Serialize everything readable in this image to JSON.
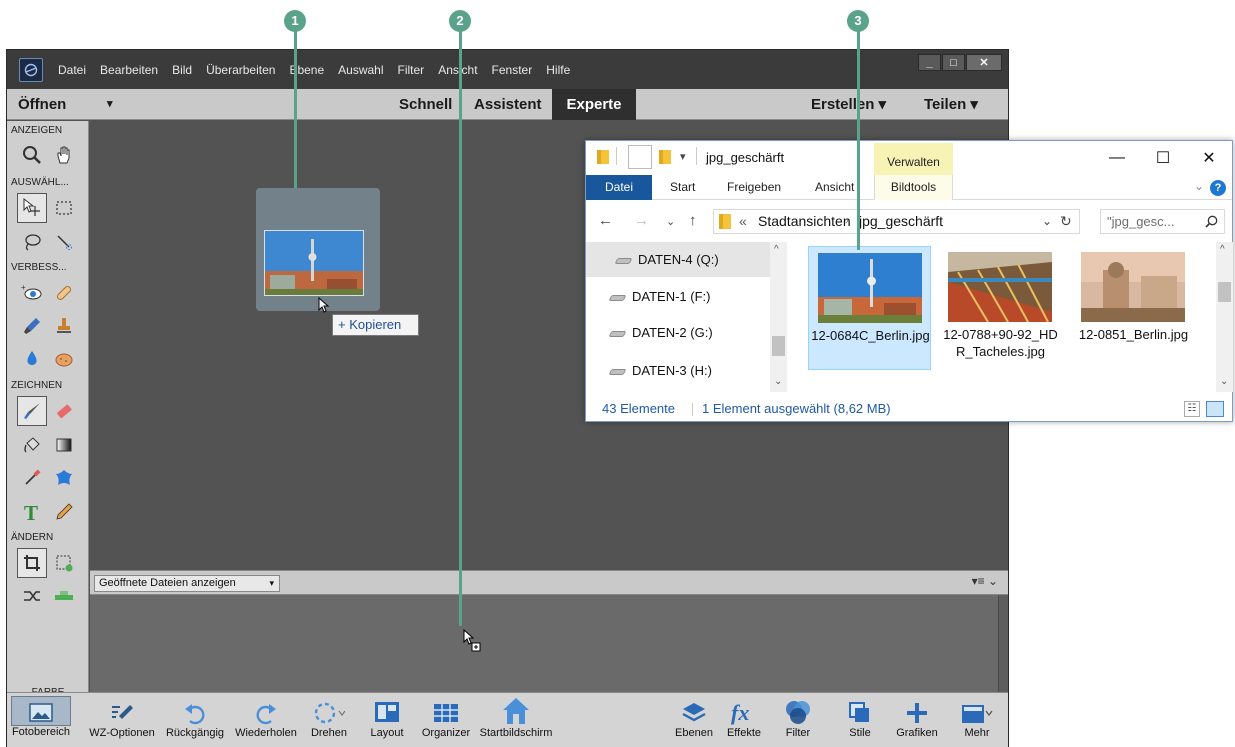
{
  "menubar": {
    "items": [
      "Datei",
      "Bearbeiten",
      "Bild",
      "Überarbeiten",
      "Ebene",
      "Auswahl",
      "Filter",
      "Ansicht",
      "Fenster",
      "Hilfe"
    ],
    "window_controls": [
      "_",
      "□",
      "✕"
    ]
  },
  "modebar": {
    "open": "Öffnen",
    "open_arrow": "▾",
    "schnell": "Schnell",
    "assistent": "Assistent",
    "experte": "Experte",
    "erstellen": "Erstellen ▾",
    "teilen": "Teilen ▾"
  },
  "toolbox": {
    "sections": [
      "ANZEIGEN",
      "AUSWÄHL...",
      "VERBESS...",
      "ZEICHNEN",
      "ÄNDERN",
      "FARBE"
    ]
  },
  "canvas": {
    "copy_tooltip": "+ Kopieren"
  },
  "bin": {
    "select_label": "Geöffnete Dateien anzeigen",
    "select_arrow": "▾",
    "right_icons": "▾≡  ⌄"
  },
  "taskbar": {
    "items": [
      "Fotobereich",
      "WZ-Optionen",
      "Rückgängig",
      "Wiederholen",
      "Drehen",
      "Layout",
      "Organizer",
      "Startbildschirm",
      "Ebenen",
      "Effekte",
      "Filter",
      "Stile",
      "Grafiken",
      "Mehr"
    ]
  },
  "explorer": {
    "title": "jpg_geschärft",
    "verwalten": "Verwalten",
    "controls": [
      "—",
      "☐",
      "✕"
    ],
    "ribbon": [
      "Datei",
      "Start",
      "Freigeben",
      "Ansicht",
      "Bildtools"
    ],
    "help": "?",
    "path_sep": "«",
    "path": [
      "Stadtansichten",
      "jpg_geschärft"
    ],
    "search_placeholder": "\"jpg_gesc...",
    "drives": [
      "DATEN-4 (Q:)",
      "DATEN-1 (F:)",
      "DATEN-2 (G:)",
      "DATEN-3 (H:)"
    ],
    "files": [
      "12-0684C_Berlin.jpg",
      "12-0788+90-92_HDR_Tacheles.jpg",
      "12-0851_Berlin.jpg"
    ],
    "status_count": "43 Elemente",
    "status_selected": "1 Element ausgewählt (8,62 MB)"
  },
  "callouts": [
    "1",
    "2",
    "3"
  ],
  "colors": {
    "callout": "#5aa38a",
    "explorer_accent": "#19579c",
    "selection": "#cce8ff",
    "foreground_swatch": "#fdd3ae",
    "background_swatch": "#ffffff"
  }
}
